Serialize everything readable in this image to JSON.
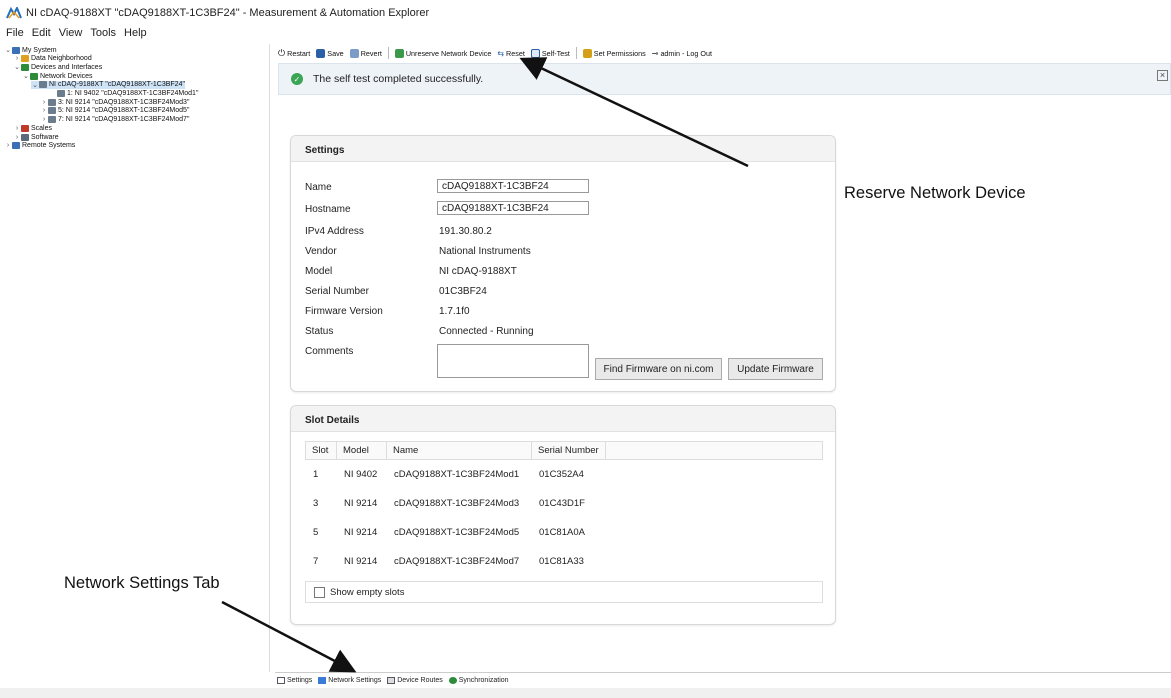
{
  "window": {
    "title": "NI cDAQ-9188XT \"cDAQ9188XT-1C3BF24\" - Measurement & Automation Explorer"
  },
  "menu": [
    "File",
    "Edit",
    "View",
    "Tools",
    "Help"
  ],
  "tree": [
    {
      "label": "My System",
      "level": 0,
      "toggle": "v",
      "color": "#3b6fb6"
    },
    {
      "label": "Data Neighborhood",
      "level": 1,
      "toggle": ">",
      "color": "#e0a020"
    },
    {
      "label": "Devices and Interfaces",
      "level": 1,
      "toggle": "v",
      "color": "#2e8b3a"
    },
    {
      "label": "Network Devices",
      "level": 2,
      "toggle": "v",
      "color": "#2e8b3a"
    },
    {
      "label": "NI cDAQ-9188XT \"cDAQ9188XT-1C3BF24\"",
      "level": 3,
      "toggle": "v",
      "color": "#6b7c8c",
      "selected": true
    },
    {
      "label": "1: NI 9402 \"cDAQ9188XT-1C3BF24Mod1\"",
      "level": 5,
      "toggle": "",
      "color": "#6b7c8c"
    },
    {
      "label": "3: NI 9214 \"cDAQ9188XT-1C3BF24Mod3\"",
      "level": 4,
      "toggle": ">",
      "color": "#6b7c8c"
    },
    {
      "label": "5: NI 9214 \"cDAQ9188XT-1C3BF24Mod5\"",
      "level": 4,
      "toggle": ">",
      "color": "#6b7c8c"
    },
    {
      "label": "7: NI 9214 \"cDAQ9188XT-1C3BF24Mod7\"",
      "level": 4,
      "toggle": ">",
      "color": "#6b7c8c"
    },
    {
      "label": "Scales",
      "level": 1,
      "toggle": ">",
      "color": "#c0392b"
    },
    {
      "label": "Software",
      "level": 1,
      "toggle": ">",
      "color": "#5b6b7b"
    },
    {
      "label": "Remote Systems",
      "level": 0,
      "toggle": ">",
      "color": "#3b6fb6"
    }
  ],
  "toolbar": {
    "restart": "Restart",
    "save": "Save",
    "revert": "Revert",
    "unreserve": "Unreserve Network Device",
    "reset": "Reset",
    "self_test": "Self-Test",
    "set_permissions": "Set Permissions",
    "logout": "admin - Log Out"
  },
  "banner": {
    "message": "The self test completed successfully."
  },
  "settings": {
    "title": "Settings",
    "name_label": "Name",
    "name_value": "cDAQ9188XT-1C3BF24",
    "hostname_label": "Hostname",
    "hostname_value": "cDAQ9188XT-1C3BF24",
    "ipv4_label": "IPv4 Address",
    "ipv4_value": "191.30.80.2",
    "vendor_label": "Vendor",
    "vendor_value": "National Instruments",
    "model_label": "Model",
    "model_value": "NI cDAQ-9188XT",
    "serial_label": "Serial Number",
    "serial_value": "01C3BF24",
    "firmware_label": "Firmware Version",
    "firmware_value": "1.7.1f0",
    "status_label": "Status",
    "status_value": "Connected - Running",
    "comments_label": "Comments",
    "find_firmware_button": "Find Firmware on ni.com",
    "update_firmware_button": "Update Firmware"
  },
  "slots": {
    "title": "Slot Details",
    "headers": [
      "Slot",
      "Model",
      "Name",
      "Serial Number"
    ],
    "rows": [
      [
        "1",
        "NI 9402",
        "cDAQ9188XT-1C3BF24Mod1",
        "01C352A4"
      ],
      [
        "3",
        "NI 9214",
        "cDAQ9188XT-1C3BF24Mod3",
        "01C43D1F"
      ],
      [
        "5",
        "NI 9214",
        "cDAQ9188XT-1C3BF24Mod5",
        "01C81A0A"
      ],
      [
        "7",
        "NI 9214",
        "cDAQ9188XT-1C3BF24Mod7",
        "01C81A33"
      ]
    ],
    "show_empty": "Show empty slots"
  },
  "tabs": [
    "Settings",
    "Network Settings",
    "Device Routes",
    "Synchronization"
  ],
  "annotations": {
    "reserve": "Reserve Network Device",
    "network_tab": "Network Settings Tab"
  }
}
